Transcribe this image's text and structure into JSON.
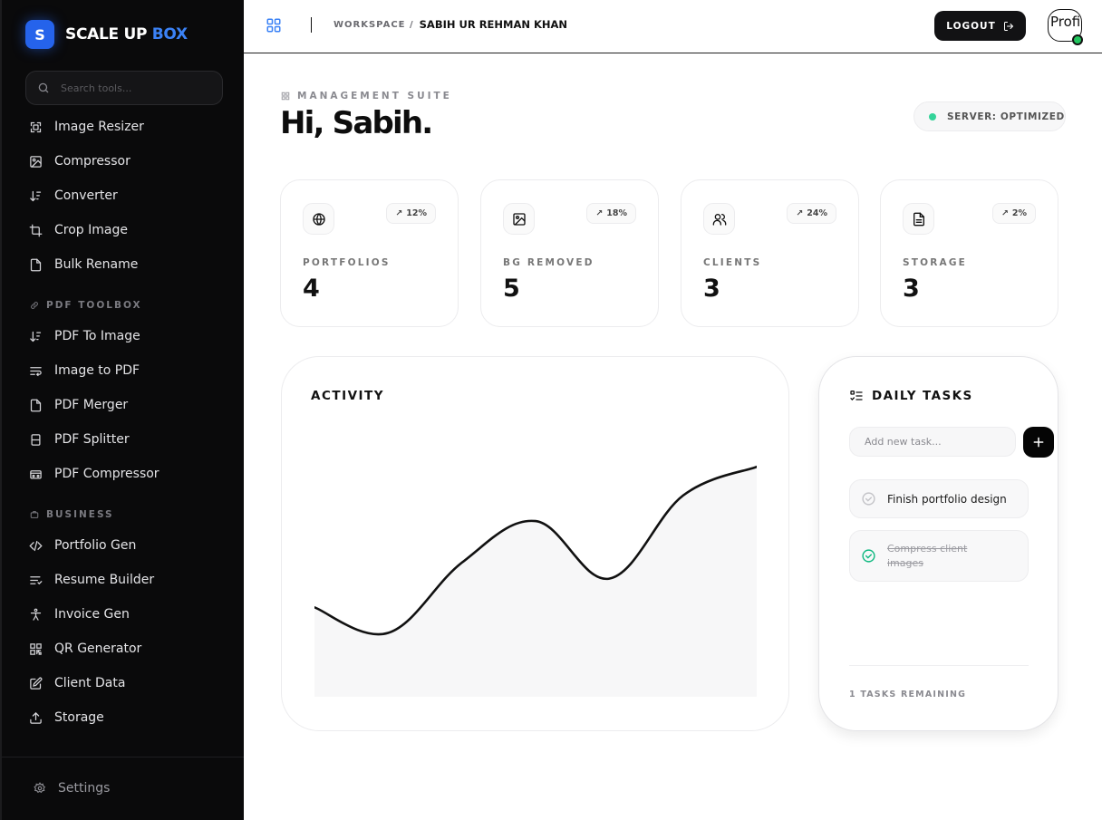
{
  "brand": {
    "logo_letter": "S",
    "name_part1": "SCALE UP ",
    "name_part2": "BOX",
    "accent_color": "#3b82f6"
  },
  "search": {
    "placeholder": "Search tools..."
  },
  "nav": {
    "tools": [
      {
        "label": "Image Resizer",
        "icon": "resize-icon"
      },
      {
        "label": "Compressor",
        "icon": "image-icon"
      },
      {
        "label": "Converter",
        "icon": "sort-arrows-icon"
      },
      {
        "label": "Crop Image",
        "icon": "crop-icon"
      },
      {
        "label": "Bulk Rename",
        "icon": "file-icon"
      }
    ],
    "pdf_section": "PDF TOOLBOX",
    "pdf": [
      {
        "label": "PDF To Image",
        "icon": "sort-arrows-icon"
      },
      {
        "label": "Image to PDF",
        "icon": "wrap-text-icon"
      },
      {
        "label": "PDF Merger",
        "icon": "file-icon"
      },
      {
        "label": "PDF Splitter",
        "icon": "split-icon"
      },
      {
        "label": "PDF Compressor",
        "icon": "archive-icon"
      }
    ],
    "business_section": "BUSINESS",
    "business": [
      {
        "label": "Portfolio Gen",
        "icon": "code-icon"
      },
      {
        "label": "Resume Builder",
        "icon": "list-icon"
      },
      {
        "label": "Invoice Gen",
        "icon": "person-icon"
      },
      {
        "label": "QR Generator",
        "icon": "qr-icon"
      },
      {
        "label": "Client Data",
        "icon": "edit-icon"
      },
      {
        "label": "Storage",
        "icon": "upload-icon"
      }
    ],
    "settings_label": "Settings"
  },
  "header": {
    "breadcrumb_root": "WORKSPACE /",
    "breadcrumb_user": "SABIH UR REHMAN KHAN",
    "logout_label": "LOGOUT",
    "avatar_text": "Profi",
    "avatar_status_color": "#22c55e"
  },
  "main": {
    "suite_label": "MANAGEMENT SUITE",
    "greeting": "Hi, Sabih.",
    "server_status": "SERVER: OPTIMIZED",
    "server_status_color": "#34d399",
    "stats": [
      {
        "label": "PORTFOLIOS",
        "value": "4",
        "trend": "12%",
        "icon": "globe-icon"
      },
      {
        "label": "BG REMOVED",
        "value": "5",
        "trend": "18%",
        "icon": "image-icon"
      },
      {
        "label": "CLIENTS",
        "value": "3",
        "trend": "24%",
        "icon": "users-icon"
      },
      {
        "label": "STORAGE",
        "value": "3",
        "trend": "2%",
        "icon": "document-icon"
      }
    ]
  },
  "activity": {
    "title": "ACTIVITY"
  },
  "chart_data": {
    "type": "area",
    "title": "ACTIVITY",
    "x": [
      1,
      2,
      3,
      4,
      5,
      6,
      7
    ],
    "values": [
      28,
      20,
      42,
      55,
      37,
      63,
      72
    ],
    "ylim": [
      0,
      80
    ],
    "xlabel": "",
    "ylabel": "",
    "grid": false,
    "line_color": "#111111",
    "fill_color": "#f7f7f8"
  },
  "tasks": {
    "title": "DAILY TASKS",
    "input_placeholder": "Add new task...",
    "items": [
      {
        "label": "Finish portfolio design",
        "done": false
      },
      {
        "label": "Compress client images",
        "done": true
      }
    ],
    "remaining": "1 TASKS REMAINING"
  }
}
